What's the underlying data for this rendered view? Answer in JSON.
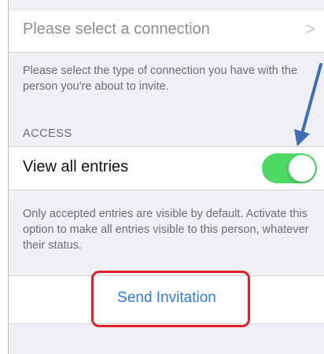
{
  "connection": {
    "placeholder": "Please select a connection",
    "chevron": ">"
  },
  "connection_help": "Please select the type of connection you have with the person you're about to invite.",
  "access": {
    "header": "ACCESS",
    "view_all_label": "View all entries",
    "view_all_enabled": true,
    "help": "Only accepted entries are visible by default. Activate this option to make all entries visible to this person, whatever their status."
  },
  "actions": {
    "send_label": "Send Invitation"
  },
  "annotations": {
    "highlight_color": "#e0232b",
    "arrow_color": "#3e6fb3"
  },
  "colors": {
    "toggle_on": "#4cd964",
    "accent": "#2d7ae5",
    "background": "#efeff4"
  }
}
